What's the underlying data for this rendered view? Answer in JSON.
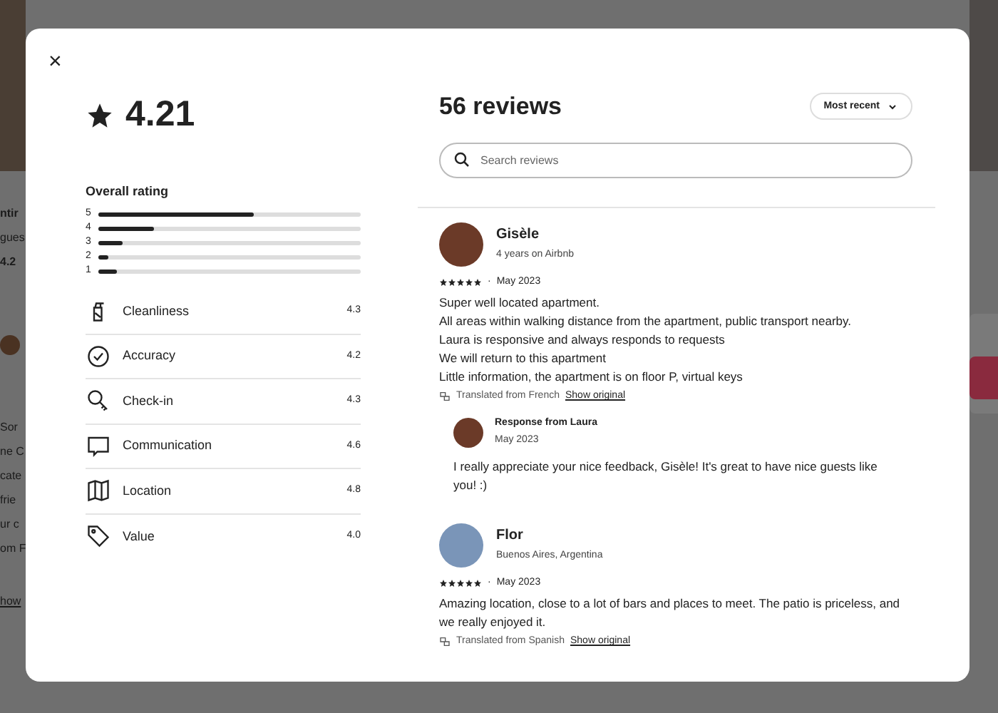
{
  "background_page": {
    "left_fragments": [
      {
        "text": "ntir",
        "kind": "title"
      },
      {
        "text": "gues",
        "kind": "text"
      },
      {
        "text": "4.2",
        "kind": "bold"
      },
      {
        "kind": "avatar"
      },
      {
        "text": "Sor",
        "kind": "text"
      },
      {
        "text": "ne C",
        "kind": "text"
      },
      {
        "text": "cate",
        "kind": "text"
      },
      {
        "text": "frie",
        "kind": "text"
      },
      {
        "text": "ur c",
        "kind": "text"
      },
      {
        "text": "om F",
        "kind": "text"
      },
      {
        "text": "how",
        "kind": "link"
      }
    ]
  },
  "modal": {
    "close_label": "×",
    "overall": {
      "score": "4.21",
      "title": "Overall rating",
      "bars": [
        {
          "label": "5",
          "level": 0.59
        },
        {
          "label": "4",
          "level": 0.21
        },
        {
          "label": "3",
          "level": 0.09
        },
        {
          "label": "2",
          "level": 0.04
        },
        {
          "label": "1",
          "level": 0.07
        }
      ]
    },
    "categories": [
      {
        "kind": "cleanliness",
        "label": "Cleanliness",
        "score": "4.3"
      },
      {
        "kind": "accuracy",
        "label": "Accuracy",
        "score": "4.2"
      },
      {
        "kind": "checkin",
        "label": "Check-in",
        "score": "4.3"
      },
      {
        "kind": "communication",
        "label": "Communication",
        "score": "4.6"
      },
      {
        "kind": "location",
        "label": "Location",
        "score": "4.8"
      },
      {
        "kind": "value",
        "label": "Value",
        "score": "4.0"
      }
    ],
    "reviews_title": "56 reviews",
    "sort": "Most recent",
    "search": {
      "placeholder": "Search reviews"
    },
    "reviews": [
      {
        "name": "Gisèle",
        "subtitle": "4 years on Airbnb",
        "stars": 5,
        "separator": "·",
        "date": "May 2023",
        "lines": [
          "Super well located apartment.",
          "All areas within walking distance from the apartment, public transport nearby.",
          "Laura is responsive and always responds to requests",
          "We will return to this apartment",
          "Little information, the apartment is on floor P, virtual keys"
        ],
        "translated": "Translated from French",
        "show_original": "Show original",
        "response": {
          "title": "Response from Laura",
          "date": "May 2023",
          "text": "I really appreciate your nice feedback, Gisèle! It's great to have nice guests like you! :)"
        }
      },
      {
        "name": "Flor",
        "subtitle": "Buenos Aires, Argentina",
        "stars": 5,
        "separator": "·",
        "date": "May 2023",
        "lines": [
          "Amazing location, close to a lot of bars and places to meet. The patio is priceless, and we really enjoyed it."
        ],
        "translated": "Translated from Spanish",
        "show_original": "Show original"
      }
    ]
  }
}
